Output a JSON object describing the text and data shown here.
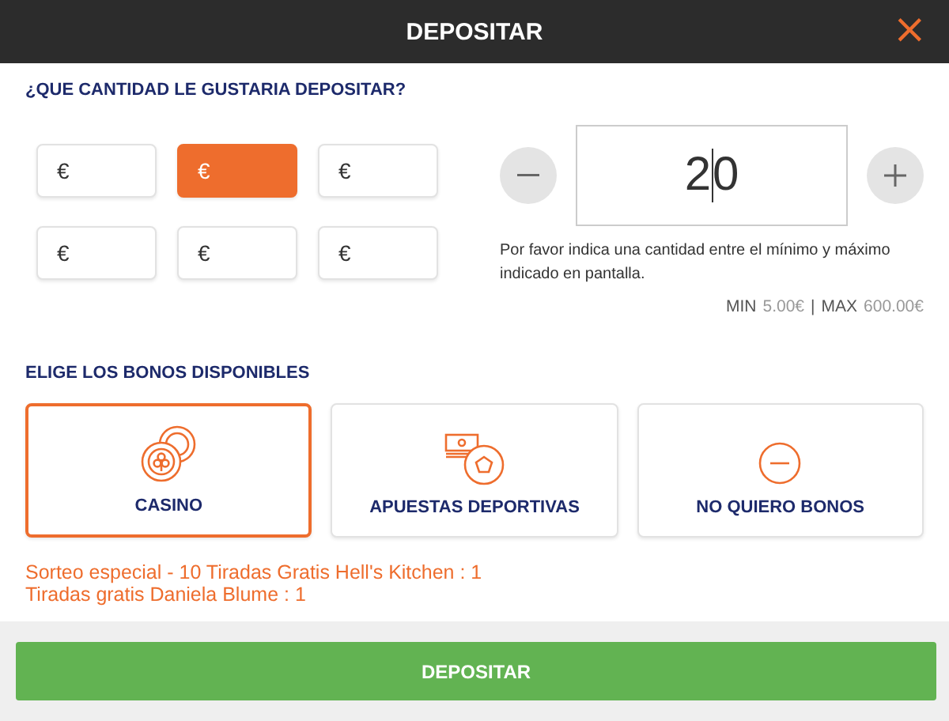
{
  "header": {
    "title": "DEPOSITAR",
    "close": "×"
  },
  "amount_section": {
    "heading": "¿QUE CANTIDAD LE GUSTARIA DEPOSITAR?",
    "presets": [
      {
        "label": "€",
        "selected": false
      },
      {
        "label": "€",
        "selected": true
      },
      {
        "label": "€",
        "selected": false
      },
      {
        "label": "€",
        "selected": false
      },
      {
        "label": "€",
        "selected": false
      },
      {
        "label": "€",
        "selected": false
      }
    ],
    "amount": {
      "value": "20"
    },
    "hint": "Por favor indica una cantidad entre el mínimo y máximo indicado en pantalla.",
    "min_label": "MIN",
    "min_value": "5.00€",
    "separator": "|",
    "max_label": "MAX",
    "max_value": "600.00€"
  },
  "bonus_section": {
    "heading": "ELIGE LOS BONOS DISPONIBLES",
    "options": [
      {
        "kind": "casino",
        "label": "CASINO",
        "selected": true
      },
      {
        "kind": "sports",
        "label": "APUESTAS DEPORTIVAS",
        "selected": false
      },
      {
        "kind": "none",
        "label": "NO QUIERO BONOS",
        "selected": false
      }
    ],
    "details": [
      "Sorteo especial - 10 Tiradas Gratis Hell's Kitchen : 1",
      "Tiradas gratis Daniela Blume : 1"
    ]
  },
  "footer": {
    "button": "DEPOSITAR"
  }
}
